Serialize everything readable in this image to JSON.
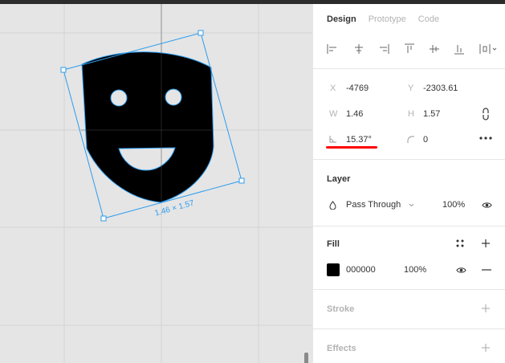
{
  "canvas": {
    "size_label": "1.46 × 1.57",
    "selection_color": "#2d9ced"
  },
  "tabs": [
    {
      "label": "Design",
      "active": true
    },
    {
      "label": "Prototype",
      "active": false
    },
    {
      "label": "Code",
      "active": false
    }
  ],
  "align": {
    "icons": [
      "align-left-icon",
      "align-horizontal-center-icon",
      "align-right-icon",
      "align-top-icon",
      "align-vertical-center-icon",
      "align-bottom-icon",
      "distribute-icon"
    ]
  },
  "transform": {
    "x_label": "X",
    "x_value": "-4769",
    "y_label": "Y",
    "y_value": "-2303.61",
    "w_label": "W",
    "w_value": "1.46",
    "h_label": "H",
    "h_value": "1.57",
    "rotation_value": "15.37°",
    "radius_value": "0"
  },
  "layer": {
    "title": "Layer",
    "blend_mode": "Pass Through",
    "opacity": "100%"
  },
  "fill": {
    "title": "Fill",
    "color_hex": "000000",
    "opacity": "100%"
  },
  "stroke": {
    "title": "Stroke"
  },
  "effects": {
    "title": "Effects"
  }
}
